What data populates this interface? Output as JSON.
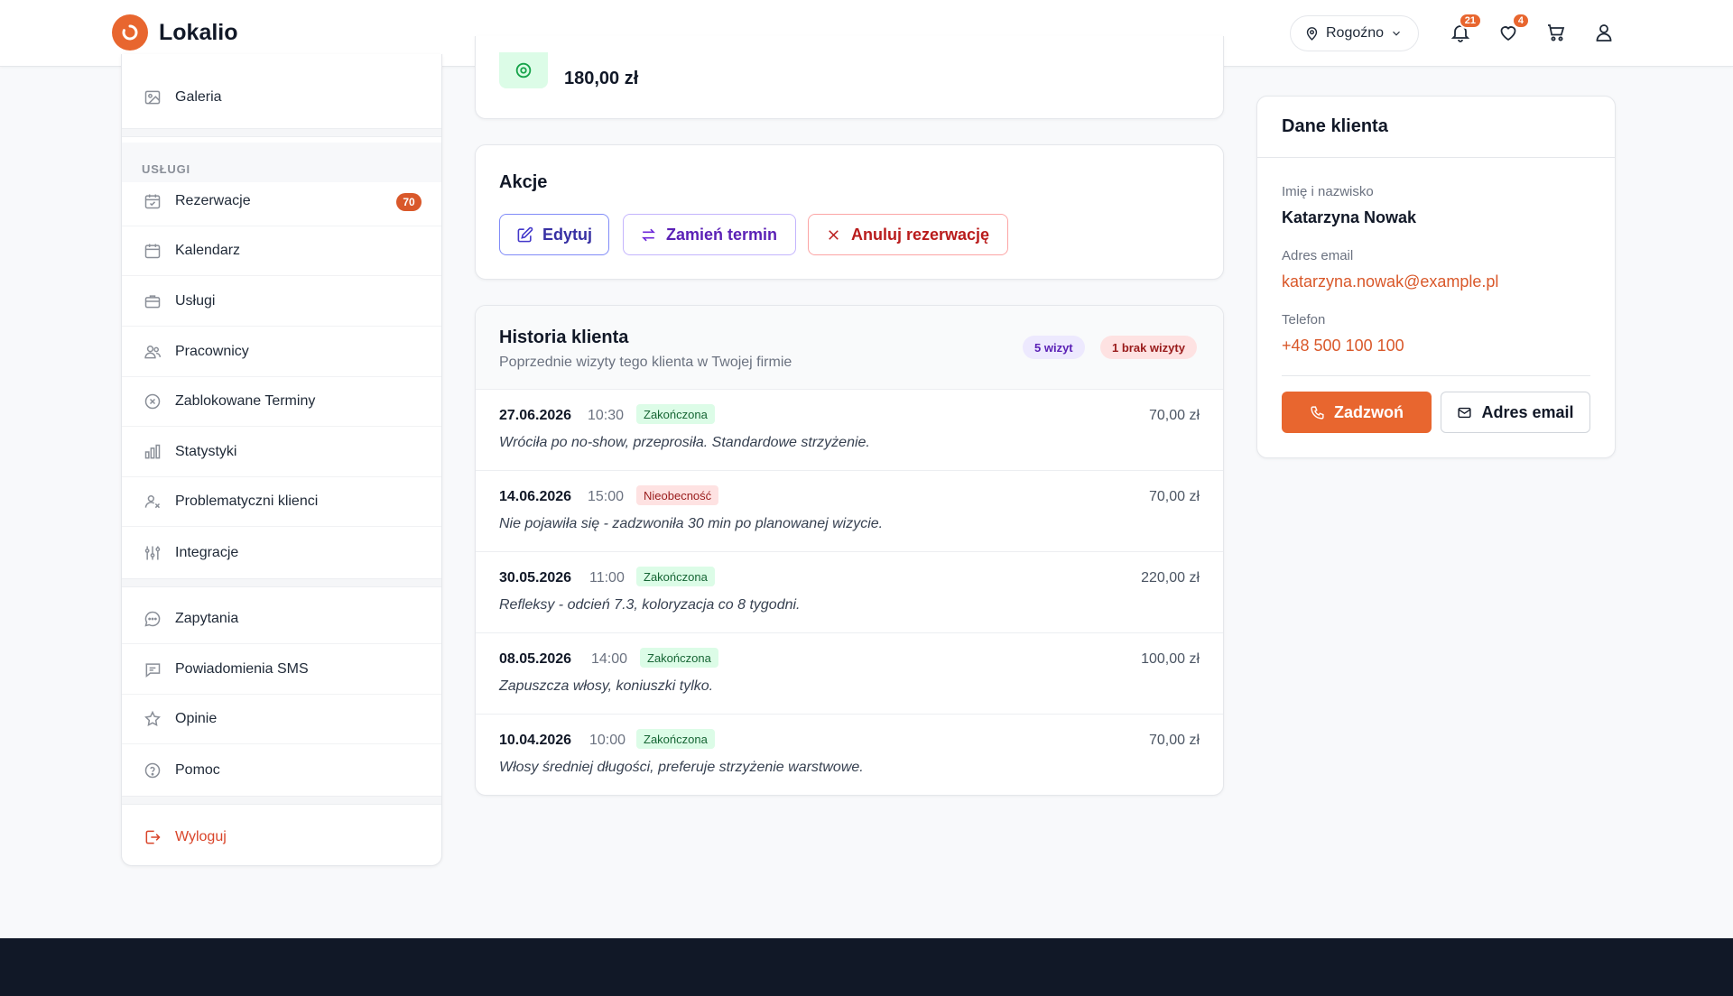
{
  "header": {
    "brand": "Lokalio",
    "location": "Rogoźno",
    "notifications_count": "21",
    "favorites_count": "4",
    "icons": [
      "bell-icon",
      "heart-icon",
      "cart-icon",
      "user-icon"
    ]
  },
  "sidebar": {
    "top_item": "Galeria",
    "section_label": "USŁUGI",
    "services": [
      {
        "label": "Rezerwacje",
        "icon": "calendar-check-icon",
        "badge": "70"
      },
      {
        "label": "Kalendarz",
        "icon": "calendar-icon"
      },
      {
        "label": "Usługi",
        "icon": "briefcase-icon"
      },
      {
        "label": "Pracownicy",
        "icon": "users-icon"
      },
      {
        "label": "Zablokowane Terminy",
        "icon": "blocked-icon"
      },
      {
        "label": "Statystyki",
        "icon": "chart-icon"
      },
      {
        "label": "Problematyczni klienci",
        "icon": "user-warning-icon"
      },
      {
        "label": "Integracje",
        "icon": "sliders-icon"
      }
    ],
    "other": [
      {
        "label": "Zapytania",
        "icon": "chat-icon"
      },
      {
        "label": "Powiadomienia SMS",
        "icon": "sms-icon"
      },
      {
        "label": "Opinie",
        "icon": "star-icon"
      },
      {
        "label": "Pomoc",
        "icon": "help-icon"
      }
    ],
    "logout": "Wyloguj"
  },
  "price_card": {
    "amount": "180,00 zł"
  },
  "actions": {
    "title": "Akcje",
    "edit": "Edytuj",
    "reschedule": "Zamień termin",
    "cancel": "Anuluj rezerwację"
  },
  "history": {
    "title": "Historia klienta",
    "subtitle": "Poprzednie wizyty tego klienta w Twojej firmie",
    "visits_badge": "5 wizyt",
    "noshow_badge": "1 brak wizyty",
    "rows": [
      {
        "date": "27.06.2026",
        "time": "10:30",
        "status": "Zakończona",
        "price": "70,00 zł",
        "note": "Wróciła po no-show, przeprosiła. Standardowe strzyżenie."
      },
      {
        "date": "14.06.2026",
        "time": "15:00",
        "status": "Nieobecność",
        "price": "70,00 zł",
        "note": "Nie pojawiła się - zadzwoniła 30 min po planowanej wizycie."
      },
      {
        "date": "30.05.2026",
        "time": "11:00",
        "status": "Zakończona",
        "price": "220,00 zł",
        "note": "Refleksy - odcień 7.3, koloryzacja co 8 tygodni."
      },
      {
        "date": "08.05.2026",
        "time": "14:00",
        "status": "Zakończona",
        "price": "100,00 zł",
        "note": "Zapuszcza włosy, koniuszki tylko."
      },
      {
        "date": "10.04.2026",
        "time": "10:00",
        "status": "Zakończona",
        "price": "70,00 zł",
        "note": "Włosy średniej długości, preferuje strzyżenie warstwowe."
      }
    ]
  },
  "client": {
    "title": "Dane klienta",
    "name_label": "Imię i nazwisko",
    "name": "Katarzyna Nowak",
    "email_label": "Adres email",
    "email": "katarzyna.nowak@example.pl",
    "phone_label": "Telefon",
    "phone": "+48 500 100 100",
    "call_button": "Zadzwoń",
    "email_button": "Adres email"
  },
  "colors": {
    "accent": "#e8662f",
    "success_bg": "#dcfce7",
    "danger_bg": "#fee2e2",
    "footer": "#111827"
  }
}
